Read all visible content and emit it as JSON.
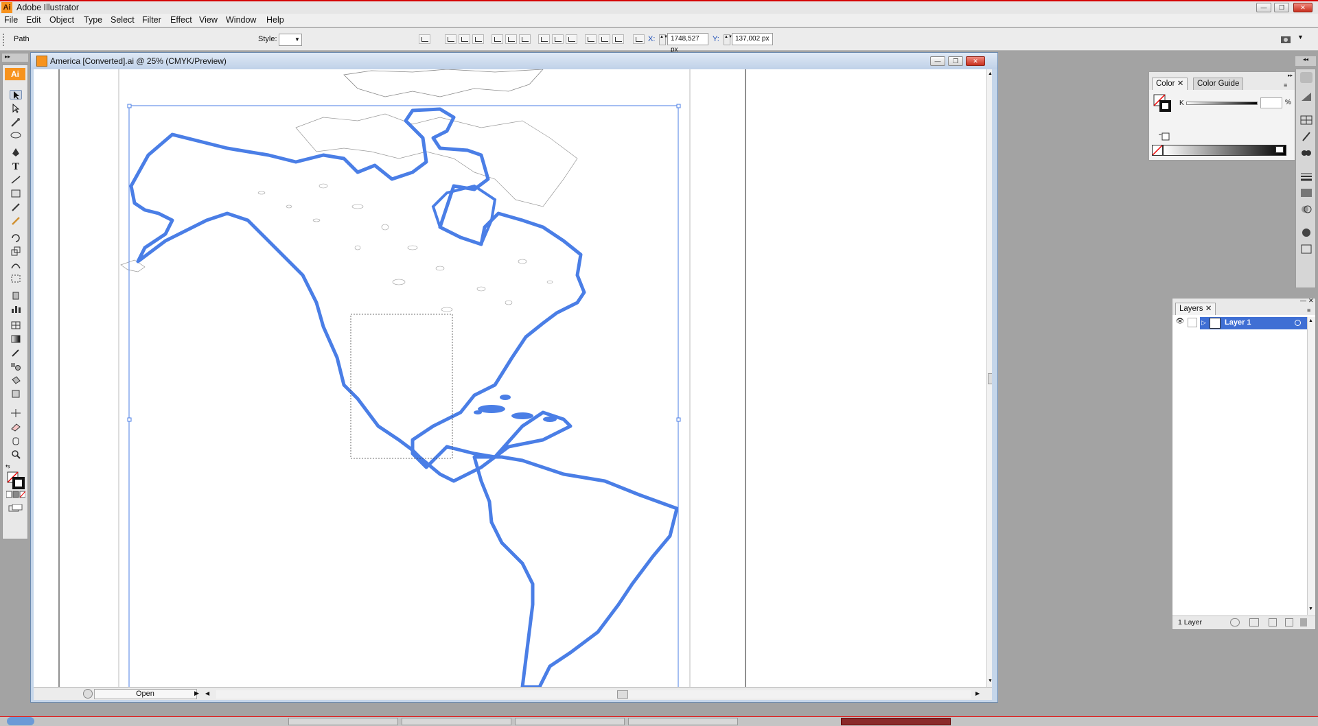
{
  "app": {
    "title": "Adobe Illustrator",
    "badge": "Ai"
  },
  "menu": [
    "File",
    "Edit",
    "Object",
    "Type",
    "Select",
    "Filter",
    "Effect",
    "View",
    "Window",
    "Help"
  ],
  "control": {
    "selection_type": "Path",
    "style_label": "Style:",
    "x_label": "X:",
    "x_value": "1748,527 px",
    "y_label": "Y:",
    "y_value": "137,002 px"
  },
  "document": {
    "title": "America [Converted].ai @ 25% (CMYK/Preview)"
  },
  "status": {
    "value": "Open"
  },
  "color_panel": {
    "tabs": [
      "Color",
      "Color Guide"
    ],
    "channel_label": "K",
    "percent_label": "%"
  },
  "layers_panel": {
    "tab": "Layers",
    "layer_name": "Layer 1",
    "footer_count": "1 Layer"
  },
  "colors": {
    "selection": "#4a7ee6",
    "accent_title_bar": "#d40000",
    "layer_highlight": "#3f6fd4"
  }
}
